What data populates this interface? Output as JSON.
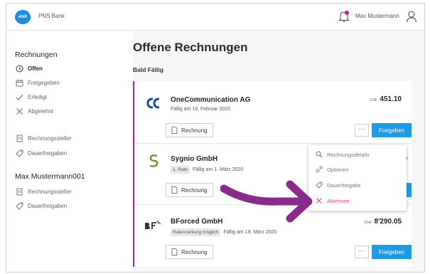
{
  "header": {
    "logo_text": "ebill",
    "bank_name": "PNS Bank",
    "user_name": "Max Mustermann"
  },
  "sidebar": {
    "section1_title": "Rechnungen",
    "items": [
      {
        "label": "Offen",
        "icon": "clock-icon"
      },
      {
        "label": "Freigegeben",
        "icon": "calendar-icon"
      },
      {
        "label": "Erledigt",
        "icon": "check-icon"
      },
      {
        "label": "Abgelehnt",
        "icon": "x-icon"
      },
      {
        "label": "Rechnungssteller",
        "icon": "document-icon"
      },
      {
        "label": "Dauerfreigaben",
        "icon": "tag-icon"
      }
    ],
    "section2_title": "Max Mustermann001",
    "items2": [
      {
        "label": "Rechnungssteller",
        "icon": "document-icon"
      },
      {
        "label": "Dauerfreigaben",
        "icon": "tag-icon"
      }
    ]
  },
  "main": {
    "title": "Offene Rechnungen",
    "section_label": "Bald Fällig"
  },
  "invoices": [
    {
      "company": "OneCommunication AG",
      "due": "Fällig am 19. Februar 2020",
      "badge": "",
      "currency": "CHF",
      "amount": "451.10",
      "invoice_button": "Rechnung",
      "more": "···",
      "approve": "Freigeben"
    },
    {
      "company": "Sygnio GmbH",
      "due": "Fällig am 1. März 2020",
      "badge": "1. Rate",
      "amount_fragment": "0",
      "invoice_button": "Rechnung"
    },
    {
      "company": "BForced GmbH",
      "due": "Fällig am 19. März 2020",
      "badge": "Ratenzahlung möglich",
      "currency": "CHF",
      "amount": "8'290.05",
      "invoice_button": "Rechnung",
      "more": "···",
      "approve": "Freigeben"
    }
  ],
  "dropdown": {
    "items": [
      {
        "label": "Rechnungsdetails",
        "icon": "search-icon"
      },
      {
        "label": "Optionen",
        "icon": "options-icon"
      },
      {
        "label": "Dauerfreigabe",
        "icon": "tag-icon"
      },
      {
        "label": "Ablehnen",
        "icon": "x-icon"
      }
    ]
  },
  "colors": {
    "accent": "#1f9be4",
    "list_border": "#c41c8c",
    "arrow": "#8a2a8c",
    "danger": "#e0485a"
  }
}
